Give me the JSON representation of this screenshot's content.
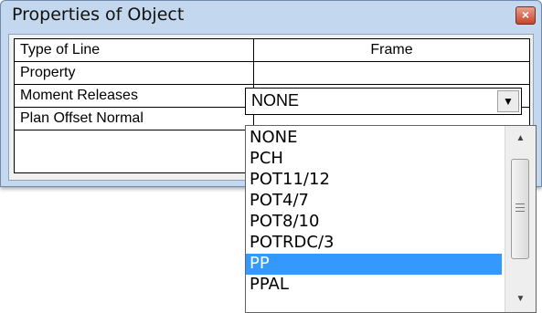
{
  "window": {
    "title": "Properties of Object",
    "close_glyph": "×"
  },
  "grid": {
    "rows": [
      {
        "label": "Type of Line",
        "value": "Frame"
      },
      {
        "label": "Property",
        "value": ""
      },
      {
        "label": "Moment Releases",
        "value": ""
      },
      {
        "label": "Plan Offset Normal",
        "value": ""
      }
    ]
  },
  "combo": {
    "selected": "NONE",
    "arrow_glyph": "▼"
  },
  "dropdown": {
    "options": [
      "NONE",
      "PCH",
      "POT11/12",
      "POT4/7",
      "POT8/10",
      "POTRDC/3",
      "PP",
      "PPAL"
    ],
    "highlighted": "PP",
    "highlight_color": "#3399ff"
  },
  "scrollbar": {
    "up_glyph": "▲",
    "down_glyph": "▼"
  }
}
